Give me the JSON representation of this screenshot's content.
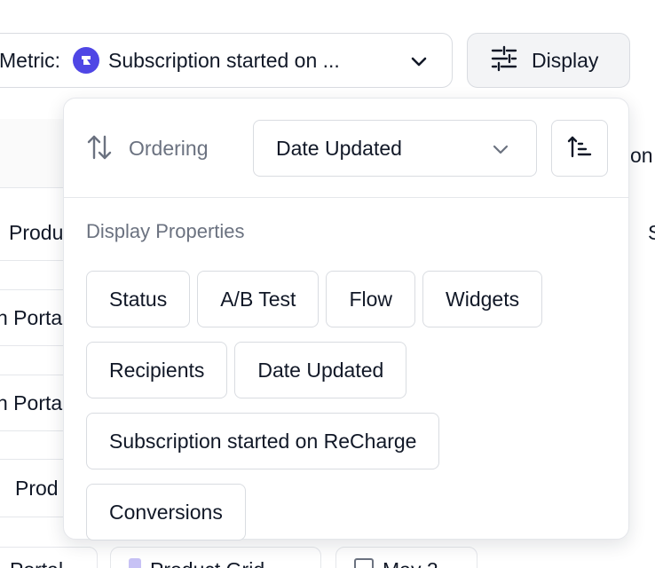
{
  "toolbar": {
    "metric_label": "Metric:",
    "metric_value": "Subscription started on ...",
    "display_label": "Display",
    "metric_logo_color": "#4f46e5"
  },
  "background": {
    "cells": [
      "Produ",
      "n Porta",
      "n Porta",
      "Prod",
      "Portal",
      "Product Grid",
      "May 2"
    ],
    "right_header_fragment": "on",
    "right_cell_fragment": "S"
  },
  "popover": {
    "ordering_label": "Ordering",
    "ordering_value": "Date Updated",
    "display_properties_heading": "Display Properties",
    "properties": [
      "Status",
      "A/B Test",
      "Flow",
      "Widgets",
      "Recipients",
      "Date Updated",
      "Subscription started on ReCharge",
      "Conversions"
    ]
  },
  "icons": {
    "metric_logo": "recharge-logo-icon",
    "metric_chevron": "chevron-down-icon",
    "display": "sliders-icon",
    "ordering": "sort-arrows-icon",
    "order_select_chevron": "chevron-down-icon",
    "direction": "sort-ascending-icon"
  }
}
